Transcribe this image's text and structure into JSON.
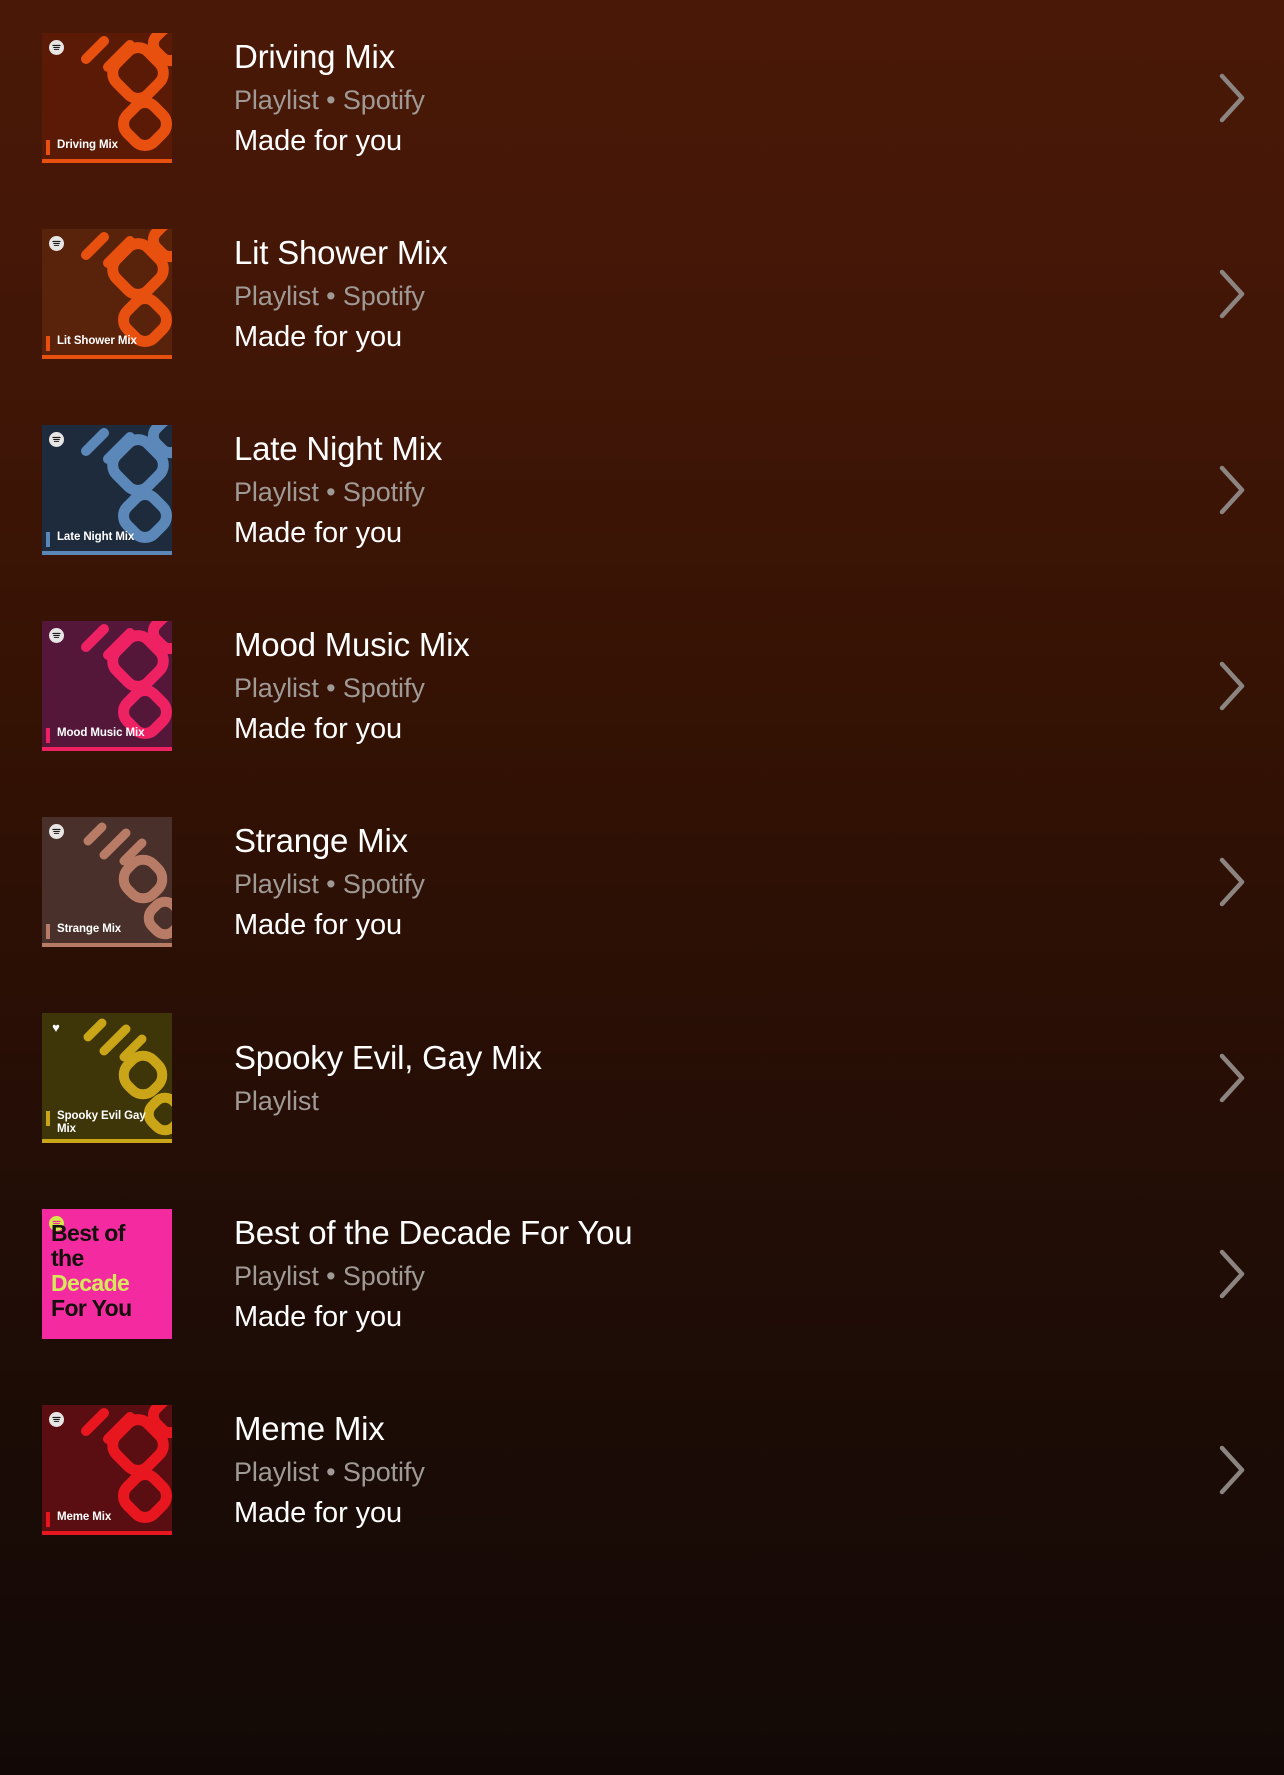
{
  "screen": {
    "background_top": "#4a1806",
    "background_bottom": "#120907",
    "chevron_color": "#8c8480"
  },
  "rows": [
    {
      "title": "Driving Mix",
      "subtitle": "Playlist • Spotify",
      "description": "Made for you",
      "chevron": "chevron-right-icon",
      "art": {
        "kind": "mix",
        "badge": "spotify-logo-icon",
        "label": "Driving Mix",
        "bg": "#5a1a05",
        "shape": "#e8500f",
        "accent": "#e8500f",
        "underline": "#e8500f",
        "motif": "diamond"
      }
    },
    {
      "title": "Lit Shower Mix",
      "subtitle": "Playlist • Spotify",
      "description": "Made for you",
      "chevron": "chevron-right-icon",
      "art": {
        "kind": "mix",
        "badge": "spotify-logo-icon",
        "label": "Lit Shower Mix",
        "bg": "#59220b",
        "shape": "#e8500f",
        "accent": "#e8500f",
        "underline": "#e8500f",
        "motif": "diamond"
      }
    },
    {
      "title": "Late Night Mix",
      "subtitle": "Playlist • Spotify",
      "description": "Made for you",
      "chevron": "chevron-right-icon",
      "art": {
        "kind": "mix",
        "badge": "spotify-logo-icon",
        "label": "Late Night Mix",
        "bg": "#1d2b3d",
        "shape": "#5b88b8",
        "accent": "#5b88b8",
        "underline": "#5b88b8",
        "motif": "diamond"
      }
    },
    {
      "title": "Mood Music Mix",
      "subtitle": "Playlist • Spotify",
      "description": "Made for you",
      "chevron": "chevron-right-icon",
      "art": {
        "kind": "mix",
        "badge": "spotify-logo-icon",
        "label": "Mood Music Mix",
        "bg": "#54173a",
        "shape": "#ee2163",
        "accent": "#ee2163",
        "underline": "#ee2163",
        "motif": "diamond"
      }
    },
    {
      "title": "Strange Mix",
      "subtitle": "Playlist • Spotify",
      "description": "Made for you",
      "chevron": "chevron-right-icon",
      "art": {
        "kind": "mix",
        "badge": "spotify-logo-icon",
        "label": "Strange Mix",
        "bg": "#4a302a",
        "shape": "#b87c66",
        "accent": "#b87c66",
        "underline": "#b87c66",
        "motif": "wave"
      }
    },
    {
      "title": "Spooky Evil, Gay Mix",
      "subtitle": "Playlist",
      "description": "",
      "chevron": "chevron-right-icon",
      "art": {
        "kind": "mix",
        "badge": "heart-icon",
        "label": "Spooky Evil Gay Mix",
        "bg": "#3e3508",
        "shape": "#c9a517",
        "accent": "#c9a517",
        "underline": "#c9a517",
        "motif": "wave"
      }
    },
    {
      "title": "Best of the Decade For You",
      "subtitle": "Playlist • Spotify",
      "description": "Made for you",
      "chevron": "chevron-right-icon",
      "art": {
        "kind": "decade",
        "badge": "spotify-logo-icon",
        "bg": "#f42ba0",
        "badge_color": "#d4e84a",
        "lines": [
          {
            "text": "Best of the",
            "color": "#14100c"
          },
          {
            "text": "Decade",
            "color": "#d7e85a"
          },
          {
            "text": "For You",
            "color": "#14100c"
          }
        ]
      }
    },
    {
      "title": "Meme Mix",
      "subtitle": "Playlist • Spotify",
      "description": "Made for you",
      "chevron": "chevron-right-icon",
      "art": {
        "kind": "mix",
        "badge": "spotify-logo-icon",
        "label": "Meme Mix",
        "bg": "#5b0e12",
        "shape": "#e8161f",
        "accent": "#e8161f",
        "underline": "#e8161f",
        "motif": "diamond"
      }
    }
  ]
}
